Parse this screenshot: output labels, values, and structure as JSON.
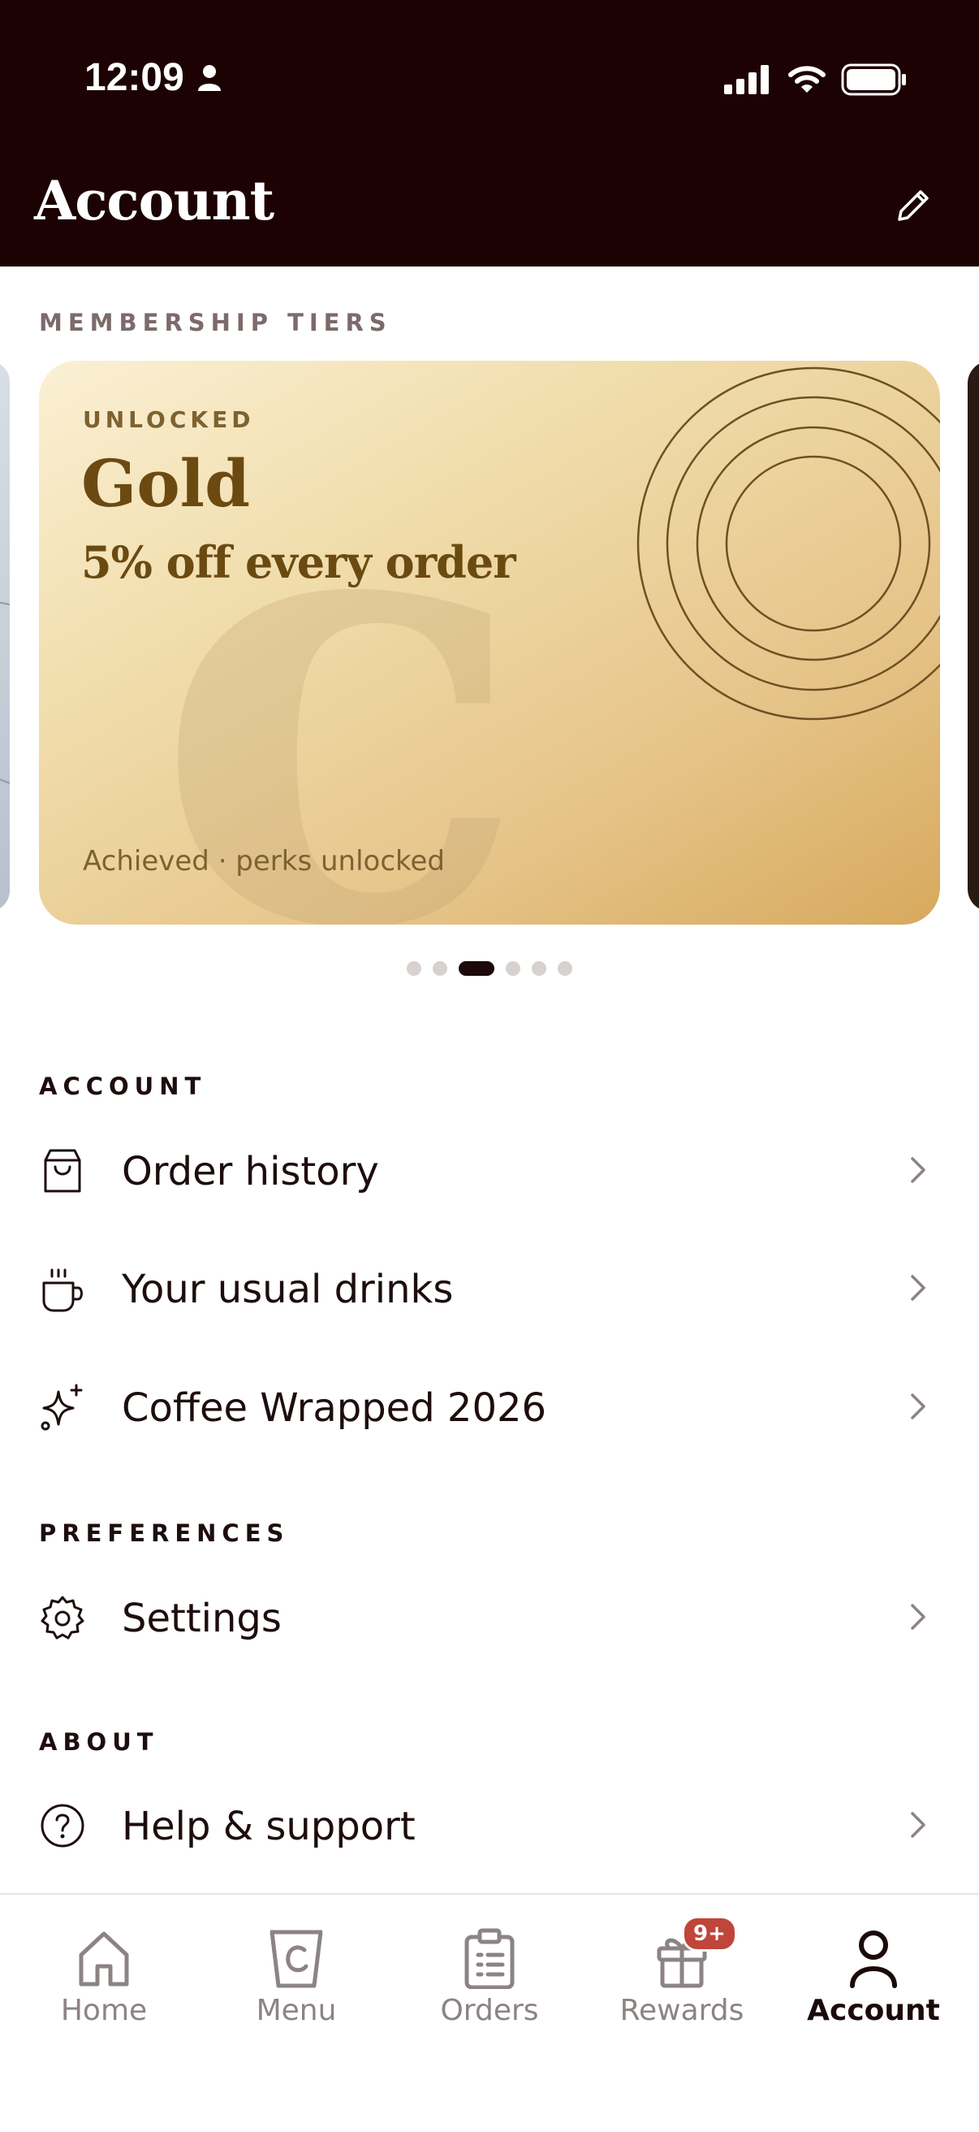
{
  "status_bar": {
    "time": "12:09"
  },
  "header": {
    "title": "Account"
  },
  "tiers": {
    "section_label": "MEMBERSHIP TIERS",
    "card": {
      "status": "UNLOCKED",
      "name": "Gold",
      "perk": "5% off every order",
      "footer": "Achieved · perks unlocked"
    },
    "pager": {
      "count": 6,
      "active_index": 2
    }
  },
  "sections": {
    "account": {
      "label": "ACCOUNT",
      "items": [
        {
          "label": "Order history",
          "icon": "shopping-bag-icon"
        },
        {
          "label": "Your usual drinks",
          "icon": "coffee-cup-icon"
        },
        {
          "label": "Coffee Wrapped 2026",
          "icon": "sparkle-icon"
        }
      ]
    },
    "preferences": {
      "label": "PREFERENCES",
      "items": [
        {
          "label": "Settings",
          "icon": "gear-icon"
        }
      ]
    },
    "about": {
      "label": "ABOUT",
      "items": [
        {
          "label": "Help & support",
          "icon": "help-circle-icon"
        }
      ]
    }
  },
  "tabbar": {
    "items": [
      {
        "label": "Home",
        "icon": "home-icon"
      },
      {
        "label": "Menu",
        "icon": "cup-icon"
      },
      {
        "label": "Orders",
        "icon": "clipboard-icon"
      },
      {
        "label": "Rewards",
        "icon": "gift-icon",
        "badge": "9+"
      },
      {
        "label": "Account",
        "icon": "person-icon",
        "active": true
      }
    ]
  },
  "colors": {
    "header_bg": "#1c0203",
    "gold_text": "#6b4a12",
    "badge": "#c0453a"
  }
}
